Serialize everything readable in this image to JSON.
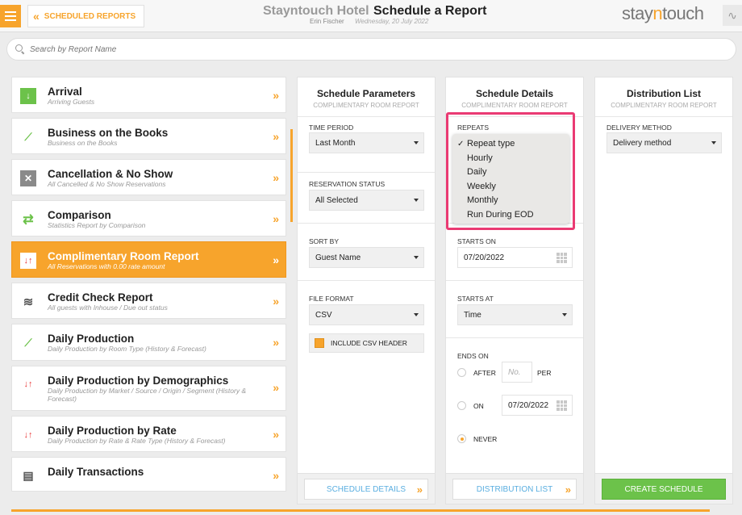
{
  "header": {
    "back_label": "SCHEDULED REPORTS",
    "hotel": "Stayntouch Hotel",
    "title": "Schedule a Report",
    "user": "Erin Fischer",
    "date": "Wednesday, 20 July 2022",
    "logo_left": "stay",
    "logo_mid": "n",
    "logo_right": "touch"
  },
  "search": {
    "placeholder": "Search by Report Name"
  },
  "reports": [
    {
      "title": "Arrival",
      "subtitle": "Arriving Guests"
    },
    {
      "title": "Business on the Books",
      "subtitle": "Business on the Books"
    },
    {
      "title": "Cancellation & No Show",
      "subtitle": "All Cancelled & No Show Reservations"
    },
    {
      "title": "Comparison",
      "subtitle": "Statistics Report by Comparison"
    },
    {
      "title": "Complimentary Room Report",
      "subtitle": "All Reservations with 0.00 rate amount"
    },
    {
      "title": "Credit Check Report",
      "subtitle": "All guests with Inhouse / Due out status"
    },
    {
      "title": "Daily Production",
      "subtitle": "Daily Production by Room Type (History & Forecast)"
    },
    {
      "title": "Daily Production by Demographics",
      "subtitle": "Daily Production by Market / Source / Origin / Segment (History & Forecast)"
    },
    {
      "title": "Daily Production by Rate",
      "subtitle": "Daily Production by Rate & Rate Type (History & Forecast)"
    },
    {
      "title": "Daily Transactions",
      "subtitle": ""
    }
  ],
  "params": {
    "heading": "Schedule Parameters",
    "subheading": "COMPLIMENTARY ROOM REPORT",
    "time_period_label": "TIME PERIOD",
    "time_period_value": "Last Month",
    "reservation_status_label": "RESERVATION STATUS",
    "reservation_status_value": "All Selected",
    "sort_by_label": "SORT BY",
    "sort_by_value": "Guest Name",
    "file_format_label": "FILE FORMAT",
    "file_format_value": "CSV",
    "csv_header_label": "INCLUDE CSV HEADER",
    "footer_button": "SCHEDULE DETAILS"
  },
  "details": {
    "heading": "Schedule Details",
    "subheading": "COMPLIMENTARY ROOM REPORT",
    "repeats_label": "REPEATS",
    "repeat_options": [
      "Repeat type",
      "Hourly",
      "Daily",
      "Weekly",
      "Monthly",
      "Run During EOD"
    ],
    "repeat_selected": "Repeat type",
    "starts_on_label": "STARTS ON",
    "starts_on_value": "07/20/2022",
    "starts_at_label": "STARTS AT",
    "starts_at_value": "Time",
    "ends_on_label": "ENDS ON",
    "after_label": "AFTER",
    "after_placeholder": "No.",
    "per_label": "PER",
    "on_label": "ON",
    "on_value": "07/20/2022",
    "never_label": "NEVER",
    "footer_button": "DISTRIBUTION LIST"
  },
  "distribution": {
    "heading": "Distribution List",
    "subheading": "COMPLIMENTARY ROOM REPORT",
    "delivery_label": "DELIVERY METHOD",
    "delivery_value": "Delivery method",
    "footer_button": "CREATE SCHEDULE"
  },
  "colors": {
    "accent": "#f7a42c",
    "create": "#6cc24a",
    "highlight": "#ea3a73",
    "link": "#5aaee0"
  }
}
